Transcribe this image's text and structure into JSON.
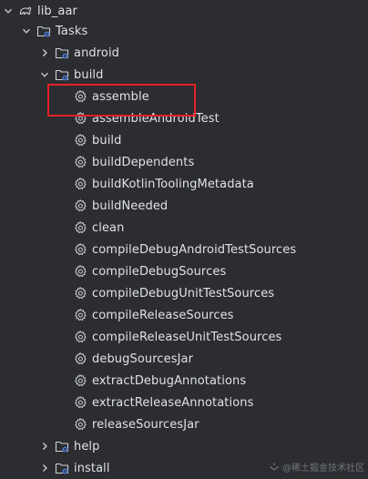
{
  "tree": {
    "root_label": "lib_aar",
    "tasks_label": "Tasks",
    "android_label": "android",
    "build_label": "build",
    "build_tasks": [
      "assemble",
      "assembleAndroidTest",
      "build",
      "buildDependents",
      "buildKotlinToolingMetadata",
      "buildNeeded",
      "clean",
      "compileDebugAndroidTestSources",
      "compileDebugSources",
      "compileDebugUnitTestSources",
      "compileReleaseSources",
      "compileReleaseUnitTestSources",
      "debugSourcesJar",
      "extractDebugAnnotations",
      "extractReleaseAnnotations",
      "releaseSourcesJar"
    ],
    "help_label": "help",
    "install_label": "install"
  },
  "icons": {
    "chevron_expanded": "chevron-down-icon",
    "chevron_collapsed": "chevron-right-icon",
    "module": "gradle-elephant-icon",
    "folder": "task-folder-icon",
    "task": "gear-icon"
  },
  "watermark": {
    "text": "@稀土掘金技术社区"
  },
  "colors": {
    "background": "#2b2d30",
    "text": "#dfe1e5",
    "highlight_box": "#e5202a",
    "folder_accent": "#548af7"
  }
}
